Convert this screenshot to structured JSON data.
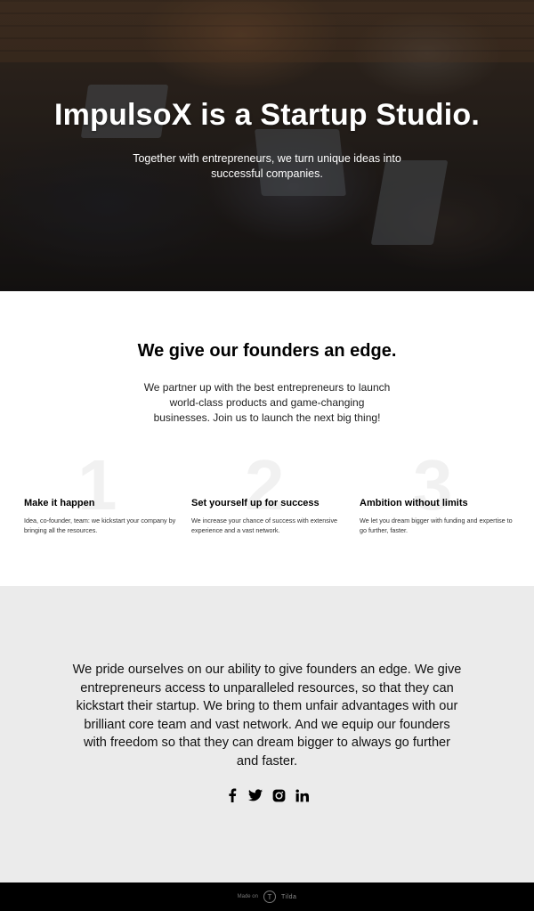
{
  "hero": {
    "title": "ImpulsoX is a Startup Studio.",
    "subtitle": "Together with entrepreneurs, we turn unique ideas into successful companies."
  },
  "edge": {
    "title": "We give our founders an edge.",
    "description": "We partner up with the best entrepreneurs to launch world-class products and game-changing businesses. Join us to launch the next big thing!",
    "features": [
      {
        "num": "1",
        "title": "Make it happen",
        "text": "Idea, co-founder, team: we kickstart your company by bringing all the resources."
      },
      {
        "num": "2",
        "title": "Set yourself up for success",
        "text": "We increase your chance of success with extensive experience and a vast network."
      },
      {
        "num": "3",
        "title": "Ambition without limits",
        "text": "We let you dream bigger with funding and expertise to go further, faster."
      }
    ]
  },
  "pride": {
    "text": "We pride ourselves on our ability to give founders an edge. We give entrepreneurs access to unparalleled resources, so that they can kickstart their startup. We bring to them unfair advantages with our brilliant core team and vast network. And we equip our founders with freedom so that they can dream bigger to always go further and faster."
  },
  "social": [
    "facebook-icon",
    "twitter-icon",
    "instagram-icon",
    "linkedin-icon"
  ],
  "footer": {
    "made_on": "Made on",
    "brand": "Tilda",
    "logo_letter": "T"
  },
  "colors": {
    "pride_bg": "#ebebeb",
    "footer_bg": "#000000",
    "number_watermark": "#f1f1f1"
  }
}
